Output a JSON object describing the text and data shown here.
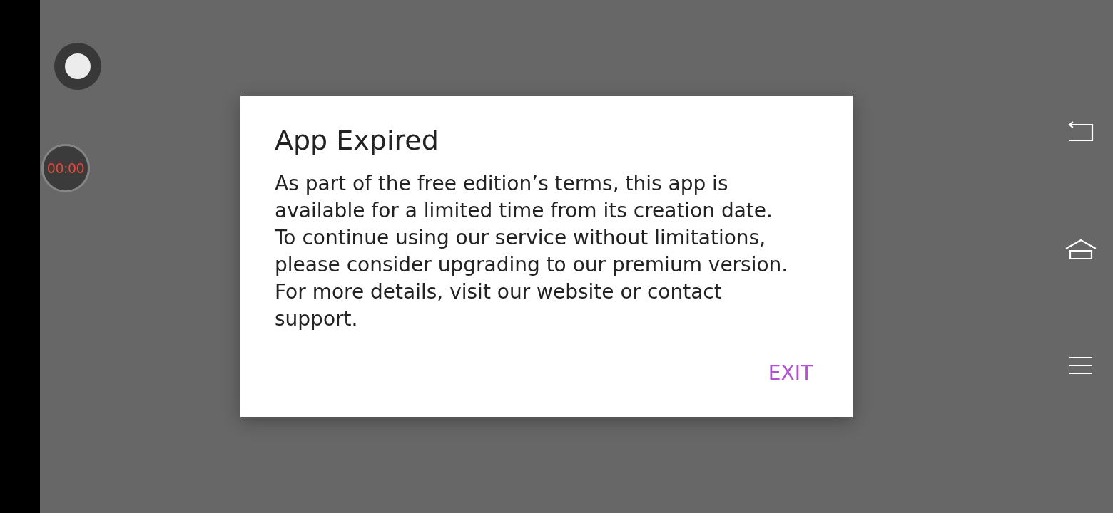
{
  "recorder": {
    "timer": "00:00"
  },
  "dialog": {
    "title": "App Expired",
    "message": "As part of the free edition’s terms, this app is available for a limited time from its creation date. To continue using our service without limitations, please consider upgrading to our premium version. For more details, visit our website or contact support.",
    "actions": [
      "EXIT"
    ]
  }
}
